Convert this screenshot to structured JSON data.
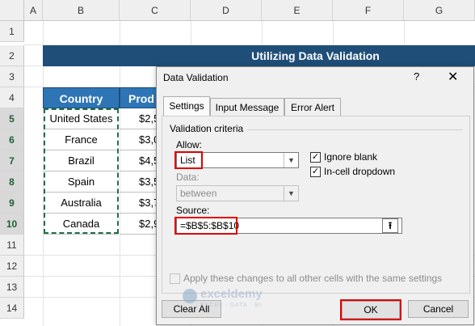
{
  "sheet": {
    "columns": [
      "A",
      "B",
      "C",
      "D",
      "E",
      "F",
      "G"
    ],
    "rows": [
      "1",
      "2",
      "3",
      "4",
      "5",
      "6",
      "7",
      "8",
      "9",
      "10",
      "11",
      "12",
      "13",
      "14"
    ],
    "title": "Utilizing Data Validation",
    "table": {
      "header_country": "Country",
      "header_product": "Prod",
      "countries": [
        "United States",
        "France",
        "Brazil",
        "Spain",
        "Australia",
        "Canada"
      ],
      "product_partials": [
        "$2,5",
        "$3,0",
        "$4,5",
        "$3,5",
        "$3,7",
        "$2,9"
      ]
    }
  },
  "dialog": {
    "title": "Data Validation",
    "help_glyph": "?",
    "close_glyph": "✕",
    "tabs": [
      "Settings",
      "Input Message",
      "Error Alert"
    ],
    "validation_criteria_label": "Validation criteria",
    "allow_label": "Allow:",
    "allow_value": "List",
    "data_label": "Data:",
    "data_value": "between",
    "ignore_blank_label": "Ignore blank",
    "ignore_blank_checked": true,
    "in_cell_dropdown_label": "In-cell dropdown",
    "in_cell_dropdown_checked": true,
    "source_label": "Source:",
    "source_value": "=$B$5:$B$10",
    "apply_all_label": "Apply these changes to all other cells with the same settings",
    "clear_all_label": "Clear All",
    "ok_label": "OK",
    "cancel_label": "Cancel"
  },
  "watermark": {
    "name": "exceldemy",
    "tagline": "EXCEL · DATA · BI"
  },
  "colors": {
    "title_bg": "#1f4e78",
    "header_bg": "#2e75b6",
    "highlight": "#e00000",
    "marquee": "#1e7145"
  }
}
